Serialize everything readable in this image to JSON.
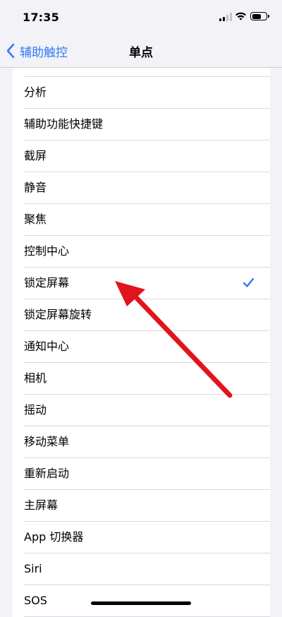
{
  "status_bar": {
    "time": "17:35",
    "signal_bars_active": 2,
    "signal_bars_total": 4,
    "battery_level": 0.75,
    "icons": [
      "cellular-signal-icon",
      "wifi-icon",
      "battery-icon"
    ]
  },
  "nav": {
    "back_label": "辅助触控",
    "title": "单点"
  },
  "actions": [
    {
      "label": "分析",
      "selected": false
    },
    {
      "label": "辅助功能快捷键",
      "selected": false
    },
    {
      "label": "截屏",
      "selected": false
    },
    {
      "label": "静音",
      "selected": false
    },
    {
      "label": "聚焦",
      "selected": false
    },
    {
      "label": "控制中心",
      "selected": false
    },
    {
      "label": "锁定屏幕",
      "selected": true
    },
    {
      "label": "锁定屏幕旋转",
      "selected": false
    },
    {
      "label": "通知中心",
      "selected": false
    },
    {
      "label": "相机",
      "selected": false
    },
    {
      "label": "摇动",
      "selected": false
    },
    {
      "label": "移动菜单",
      "selected": false
    },
    {
      "label": "重新启动",
      "selected": false
    },
    {
      "label": "主屏幕",
      "selected": false
    },
    {
      "label": "App 切换器",
      "selected": false
    },
    {
      "label": "Siri",
      "selected": false
    },
    {
      "label": "SOS",
      "selected": false
    }
  ],
  "colors": {
    "accent": "#3478f6",
    "background": "#f2f2f7",
    "annotation_arrow": "#e0141c"
  }
}
